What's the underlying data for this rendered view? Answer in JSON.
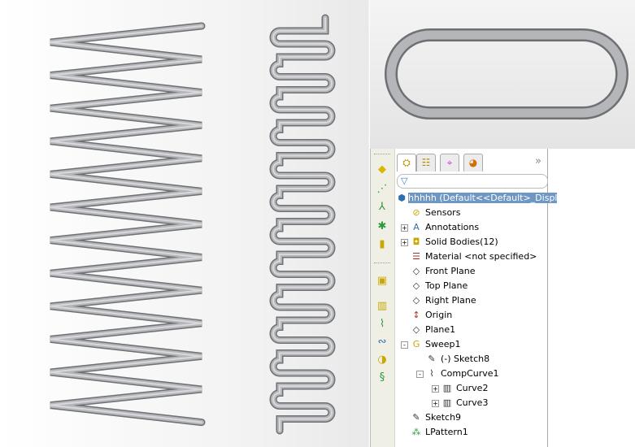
{
  "tree": {
    "root": "hhhhh  (Default<<Default>_Displ",
    "items": [
      {
        "label": "Sensors",
        "icon": "sensors-folder-icon",
        "expander": ""
      },
      {
        "label": "Annotations",
        "icon": "annotations-folder-icon",
        "expander": "+"
      },
      {
        "label": "Solid Bodies(12)",
        "icon": "solid-bodies-folder-icon",
        "expander": "+"
      },
      {
        "label": "Material <not specified>",
        "icon": "material-icon",
        "expander": ""
      },
      {
        "label": "Front Plane",
        "icon": "plane-icon",
        "expander": ""
      },
      {
        "label": "Top Plane",
        "icon": "plane-icon",
        "expander": ""
      },
      {
        "label": "Right Plane",
        "icon": "plane-icon",
        "expander": ""
      },
      {
        "label": "Origin",
        "icon": "origin-icon",
        "expander": ""
      },
      {
        "label": "Plane1",
        "icon": "plane-icon",
        "expander": ""
      },
      {
        "label": "Sweep1",
        "icon": "sweep-icon",
        "expander": "-"
      },
      {
        "label": "(-) Sketch8",
        "icon": "sketch-icon",
        "expander": ""
      },
      {
        "label": "CompCurve1",
        "icon": "composite-curve-icon",
        "expander": "-"
      },
      {
        "label": "Curve2",
        "icon": "curve-icon",
        "expander": "+"
      },
      {
        "label": "Curve3",
        "icon": "curve-icon",
        "expander": "+"
      },
      {
        "label": "Sketch9",
        "icon": "sketch-icon",
        "expander": ""
      },
      {
        "label": "LPattern1",
        "icon": "linear-pattern-icon",
        "expander": ""
      }
    ]
  },
  "tabs": [
    "feature-manager",
    "property-manager",
    "configuration-manager",
    "display-manager"
  ],
  "colors": {
    "selection": "#6f97c4",
    "tube": "#a9abaf"
  }
}
